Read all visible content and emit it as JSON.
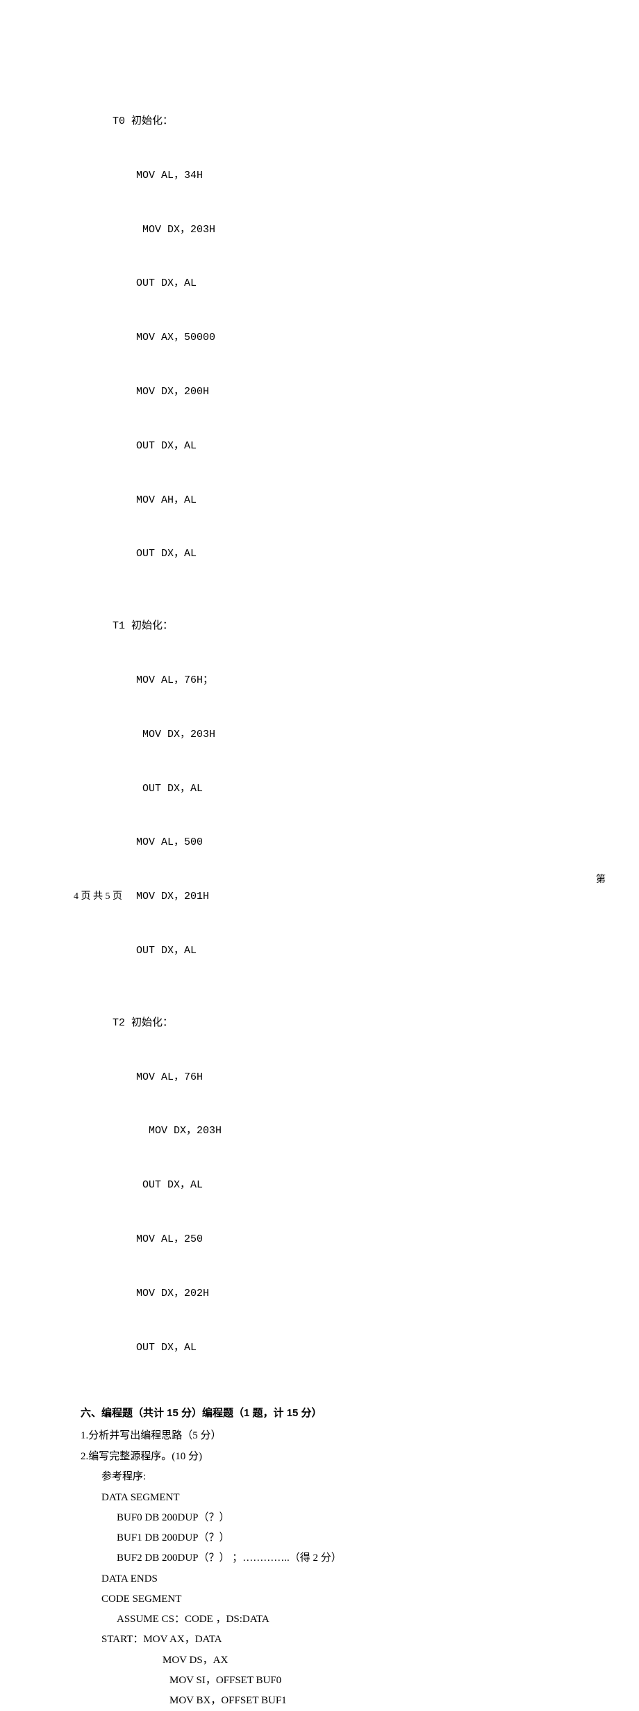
{
  "code": {
    "t0": {
      "label": "T0 初始化：",
      "lines": [
        "MOV AL，34H",
        " MOV DX，203H",
        "OUT DX，AL",
        "MOV AX，50000",
        "MOV DX，200H",
        "OUT DX，AL",
        "MOV AH，AL",
        "OUT DX，AL"
      ]
    },
    "t1": {
      "label": "T1 初始化：",
      "lines": [
        "MOV AL，76H；",
        " MOV DX，203H",
        " OUT DX，AL",
        "MOV AL，500",
        "MOV DX，201H",
        "OUT DX，AL"
      ]
    },
    "t2": {
      "label": "T2 初始化：",
      "lines": [
        "MOV AL，76H",
        "  MOV DX，203H",
        " OUT DX，AL",
        "MOV AL，250",
        "MOV DX，202H",
        "OUT DX，AL"
      ]
    }
  },
  "section6": {
    "heading": "六、编程题（共计 15 分）编程题（1 题，计 15 分）",
    "q1": "1.分析并写出编程思路（5 分）",
    "q2": "2.编写完整源程序。(10 分)",
    "ref": "参考程序:",
    "prog": [
      "DATA   SEGMENT",
      "BUF0 DB 200DUP（？）",
      "BUF1 DB 200DUP（？）",
      "BUF2 DB 200DUP（？）   ；…………..（得 2 分）",
      "DATA ENDS",
      "CODE SEGMENT",
      "ASSUME CS：CODE ，DS:DATA",
      "START：MOV AX，DATA",
      "MOV   DS，AX",
      "MOV    SI，OFFSET BUF0",
      "MOV    BX，OFFSET BUF1"
    ]
  },
  "footer": {
    "right": "第",
    "left": "4 页 共 5 页"
  }
}
